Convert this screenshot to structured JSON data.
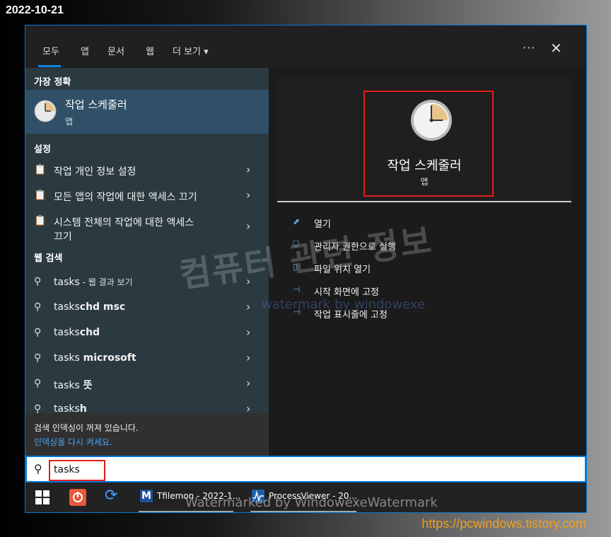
{
  "overlay": {
    "date": "2022-10-21",
    "url": "https://pcwindows.tistory.com",
    "watermark_ko": "컴퓨터 관련 정보",
    "watermark_en": "watermark by windowexe",
    "watermark_bottom": "Watermarked by WindowexeWatermark"
  },
  "tabs": [
    "모두",
    "앱",
    "문서",
    "웹",
    "더 보기 ▾"
  ],
  "window_controls": {
    "more": "···",
    "close": "✕"
  },
  "left": {
    "best_match_header": "가장 정확",
    "best_match": {
      "title": "작업 스케줄러",
      "subtitle": "앱"
    },
    "settings_header": "설정",
    "settings": [
      {
        "label": "작업 개인 정보 설정"
      },
      {
        "label": "모든 앱의 작업에 대한 액세스 끄기"
      },
      {
        "label": "시스템 전체의 작업에 대한 액세스",
        "label2": "끄기"
      }
    ],
    "web_header": "웹 검색",
    "web": [
      {
        "prefix": "tasks",
        "bold": "",
        "suffix": " - 웹 결과 보기"
      },
      {
        "prefix": "tasks",
        "bold": "chd msc",
        "suffix": ""
      },
      {
        "prefix": "tasks",
        "bold": "chd",
        "suffix": ""
      },
      {
        "prefix": "tasks",
        "bold": " microsoft",
        "suffix": ""
      },
      {
        "prefix": "tasks",
        "bold": " 뜻",
        "suffix": ""
      },
      {
        "prefix": "tasks",
        "bold": "h",
        "suffix": ""
      }
    ],
    "indexing_notice": "검색 인덱싱이 꺼져 있습니다.",
    "indexing_link": "인덱싱을 다시 켜세요."
  },
  "right": {
    "title": "작업 스케줄러",
    "subtitle": "앱",
    "actions": [
      {
        "icon": "open-icon",
        "label": "열기"
      },
      {
        "icon": "shield-icon",
        "label": "관리자 권한으로 실행"
      },
      {
        "icon": "folder-icon",
        "label": "파일 위치 열기"
      },
      {
        "icon": "pin-icon",
        "label": "시작 화면에 고정"
      },
      {
        "icon": "pin-icon",
        "label": "작업 표시줄에 고정"
      }
    ]
  },
  "search": {
    "value": "tasks"
  },
  "taskbar": {
    "tfile_icon_letter": "M",
    "tfile_label": "Tfilemon - 2022-1...",
    "pv_label": "ProcessViewer - 20..."
  }
}
